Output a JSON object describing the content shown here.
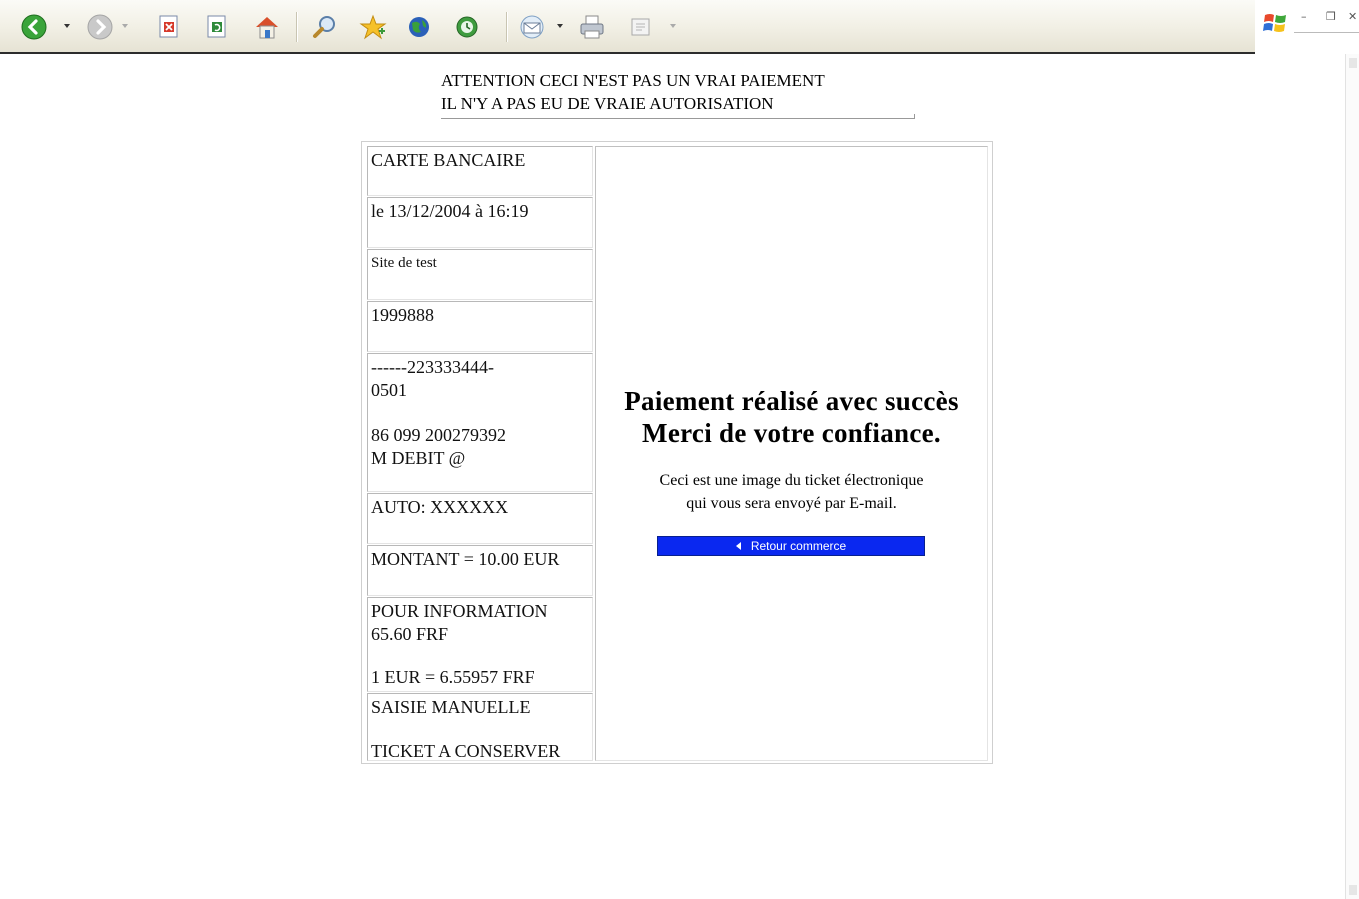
{
  "warning": {
    "line1": "ATTENTION CECI N'EST PAS UN VRAI PAIEMENT",
    "line2": "IL N'Y A PAS EU DE VRAIE AUTORISATION"
  },
  "ticket": {
    "card_type": "CARTE BANCAIRE",
    "datetime": "le 13/12/2004 à 16:19",
    "merchant": "Site de test",
    "merchant_id": "1999888",
    "card_line1": "------223333444-",
    "card_line2": "0501",
    "ref_line1": "86 099 200279392",
    "ref_line2": "M DEBIT @",
    "auto": "AUTO: XXXXXX",
    "amount": "MONTANT = 10.00 EUR",
    "info_line1": "POUR INFORMATION",
    "info_line2": "65.60 FRF",
    "rate": "1 EUR = 6.55957 FRF",
    "entry": "SAISIE MANUELLE",
    "keep": "TICKET A CONSERVER"
  },
  "result": {
    "title_line1": "Paiement réalisé avec succès",
    "title_line2": "Merci de votre confiance.",
    "note_line1": "Ceci est une image du ticket électronique",
    "note_line2": "qui vous sera envoyé par E-mail.",
    "back_button": "Retour commerce"
  },
  "colors": {
    "button_bg": "#0a28f0",
    "toolbar_bg": "#f1efe4"
  },
  "icons": [
    "back-icon",
    "forward-icon",
    "stop-icon",
    "refresh-icon",
    "home-icon",
    "search-icon",
    "favorites-icon",
    "media-icon",
    "history-icon",
    "mail-icon",
    "print-icon",
    "edit-icon",
    "windows-logo-icon"
  ]
}
